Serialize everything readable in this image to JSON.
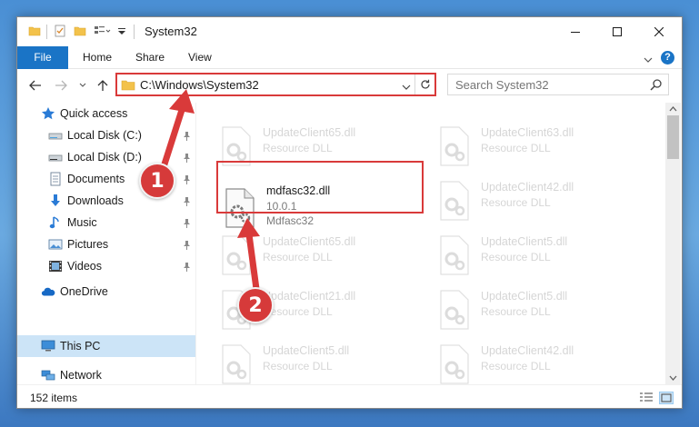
{
  "window": {
    "title": "System32",
    "caption": {
      "minimize": "–",
      "maximize": "□",
      "close": "✕"
    }
  },
  "ribbon": {
    "tabs": [
      {
        "label": "File",
        "active": true
      },
      {
        "label": "Home"
      },
      {
        "label": "Share"
      },
      {
        "label": "View"
      }
    ],
    "help": "?"
  },
  "address_bar": {
    "path": "C:\\Windows\\System32"
  },
  "search": {
    "placeholder": "Search System32"
  },
  "navigation": {
    "items": [
      {
        "label": "Quick access",
        "icon": "star-icon",
        "pinned": false
      },
      {
        "label": "Local Disk (C:)",
        "icon": "drive-icon",
        "pinned": true
      },
      {
        "label": "Local Disk (D:)",
        "icon": "drive-icon",
        "pinned": true
      },
      {
        "label": "Documents",
        "icon": "documents-icon",
        "pinned": true
      },
      {
        "label": "Downloads",
        "icon": "download-icon",
        "pinned": true
      },
      {
        "label": "Music",
        "icon": "music-icon",
        "pinned": true
      },
      {
        "label": "Pictures",
        "icon": "pictures-icon",
        "pinned": true
      },
      {
        "label": "Videos",
        "icon": "videos-icon",
        "pinned": true
      },
      {
        "label": "OneDrive",
        "icon": "cloud-icon",
        "pinned": false
      },
      {
        "label": "This PC",
        "icon": "computer-icon",
        "pinned": false,
        "selected": true
      },
      {
        "label": "Network",
        "icon": "network-icon",
        "pinned": false
      }
    ]
  },
  "files": {
    "highlighted": {
      "name": "mdfasc32.dll",
      "version": "10.0.1",
      "description": "Mdfasc32"
    },
    "background": [
      {
        "name": "UpdateClient65.dll",
        "type": "Resource DLL"
      },
      {
        "name": "UpdateClient63.dll",
        "type": "Resource DLL"
      },
      {
        "name": "UpdateClient42.dll",
        "type": "Resource DLL"
      },
      {
        "name": "UpdateClient65.dll",
        "type": "Resource DLL"
      },
      {
        "name": "UpdateClient5.dll",
        "type": "Resource DLL"
      },
      {
        "name": "UpdateClient21.dll",
        "type": "Resource DLL"
      },
      {
        "name": "UpdateClient5.dll",
        "type": "Resource DLL"
      },
      {
        "name": "UpdateClient5.dll",
        "type": "Resource DLL"
      },
      {
        "name": "UpdateClient42.dll",
        "type": "Resource DLL"
      }
    ]
  },
  "status": {
    "item_count": "152 items"
  },
  "annotations": {
    "step1": "1",
    "step2": "2",
    "color": "#d93a3a"
  }
}
